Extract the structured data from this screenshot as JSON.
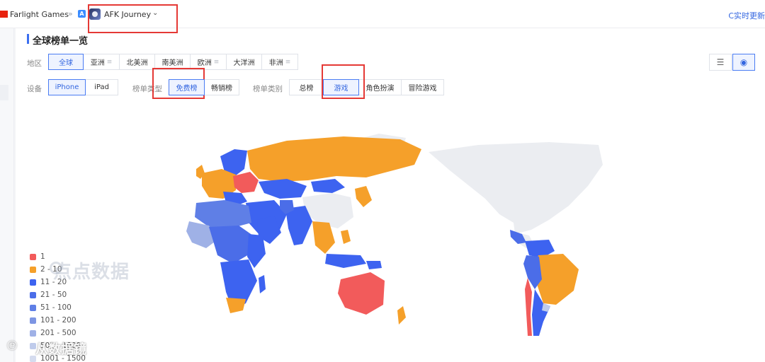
{
  "header": {
    "publisher": "Farlight Games",
    "breadcrumb_sep": "»",
    "store_badge": "A",
    "app_name": "AFK Journey",
    "dropdown_caret": "⌄",
    "realtime_label": "C实时更新"
  },
  "page": {
    "title": "全球榜单一览"
  },
  "filters": {
    "region_label": "地区",
    "regions": [
      "全球",
      "亚洲",
      "北美洲",
      "南美洲",
      "欧洲",
      "大洋洲",
      "非洲"
    ],
    "region_selected": "全球",
    "device_label": "设备",
    "devices": [
      "iPhone",
      "iPad"
    ],
    "device_selected": "iPhone",
    "chart_type_label": "榜单类型",
    "chart_types": [
      "免费榜",
      "畅销榜"
    ],
    "chart_type_selected": "免费榜",
    "category_label": "榜单类别",
    "categories": [
      "总榜",
      "游戏",
      "角色扮演",
      "冒险游戏"
    ],
    "category_selected": "游戏"
  },
  "view_toggle": {
    "list_icon": "list-icon",
    "map_icon": "globe-icon",
    "selected": "map"
  },
  "legend": [
    {
      "label": "1",
      "color": "#f25b5b"
    },
    {
      "label": "2 - 10",
      "color": "#f5a02a"
    },
    {
      "label": "11 - 20",
      "color": "#3d63f0"
    },
    {
      "label": "21 - 50",
      "color": "#4b6de8"
    },
    {
      "label": "51 - 100",
      "color": "#5f7fe6"
    },
    {
      "label": "101 - 200",
      "color": "#7d95e3"
    },
    {
      "label": "201 - 500",
      "color": "#9fb1e6"
    },
    {
      "label": "501 - 1000",
      "color": "#bfcbeb"
    },
    {
      "label": "1001 - 1500",
      "color": "#d5dcef"
    }
  ],
  "colors": {
    "accent": "#3366e0",
    "annotation": "#e53935",
    "unranked": "#ebedf1"
  },
  "watermarks": {
    "primary": "点点数据",
    "secondary": "从数据镜"
  }
}
